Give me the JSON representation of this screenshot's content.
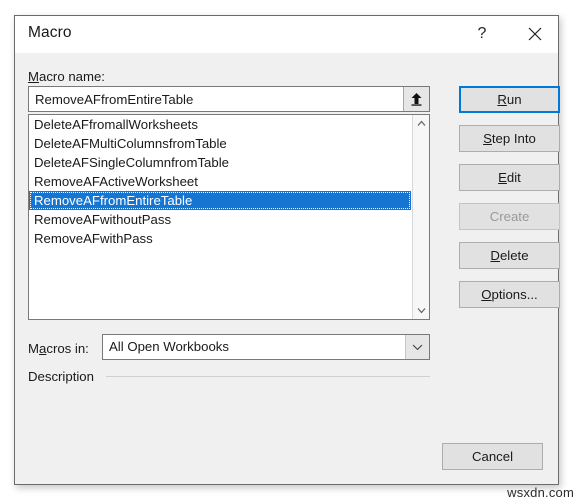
{
  "dialog": {
    "title": "Macro",
    "help_icon": "question-mark-icon",
    "close_icon": "close-icon"
  },
  "macro_name": {
    "label": "Macro name:",
    "label_accel": "M",
    "value": "RemoveAFfromEntireTable",
    "placeholder": "",
    "spin_icon": "arrow-up-icon"
  },
  "macro_list": {
    "items": [
      "DeleteAFfromallWorksheets",
      "DeleteAFMultiColumnsfromTable",
      "DeleteAFSingleColumnfromTable",
      "RemoveAFActiveWorksheet",
      "RemoveAFfromEntireTable",
      "RemoveAFwithoutPass",
      "RemoveAFwithPass"
    ],
    "selected_index": 4,
    "scroll_up_icon": "chevron-up-icon",
    "scroll_down_icon": "chevron-down-icon"
  },
  "buttons": {
    "run": "Run",
    "step_into": "Step Into",
    "edit": "Edit",
    "create": "Create",
    "delete": "Delete",
    "options": "Options...",
    "cancel": "Cancel"
  },
  "button_states": {
    "run": "default-focused",
    "create": "disabled"
  },
  "macros_in": {
    "label": "Macros in:",
    "value": "All Open Workbooks",
    "arrow_icon": "chevron-down-icon"
  },
  "description": {
    "label": "Description"
  },
  "watermark": {
    "text": "wsxdn.com"
  },
  "colors": {
    "accent": "#0078d7",
    "selection": "#1675d1",
    "dialog_bg": "#f0f0f0",
    "titlebar_bg": "#ffffff",
    "button_bg": "#e1e1e1"
  }
}
